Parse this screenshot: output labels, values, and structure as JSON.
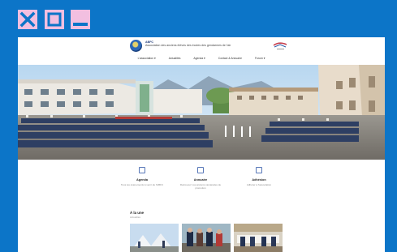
{
  "window": {
    "controls": [
      "close-icon",
      "maximize-icon",
      "minimize-icon"
    ],
    "frame_color": "#0c75c8",
    "button_color": "#f2bfe0",
    "glyph_color": "#0c75c8"
  },
  "site": {
    "brand_short": "ABFC",
    "brand_full": "Association des anciens élèves des écoles des gendarmes de l'air",
    "nav": [
      "L'association ▾",
      "Actualités",
      "Agenda ▾",
      "Contact & Annuaire",
      "Forum ▾"
    ]
  },
  "quick_links": [
    {
      "icon": "calendar-icon",
      "title": "Agenda",
      "desc": "Tous les événements à venir de l'ABFC"
    },
    {
      "icon": "directory-icon",
      "title": "Annuaire",
      "desc": "Retrouvez vos anciens camarades de promotion"
    },
    {
      "icon": "membership-icon",
      "title": "Adhésion",
      "desc": "Adhérer à l'association"
    }
  ],
  "news": {
    "title": "À la une",
    "subtitle": "Actualités",
    "cards": [
      "news-card-1",
      "news-card-2",
      "news-card-3"
    ]
  }
}
